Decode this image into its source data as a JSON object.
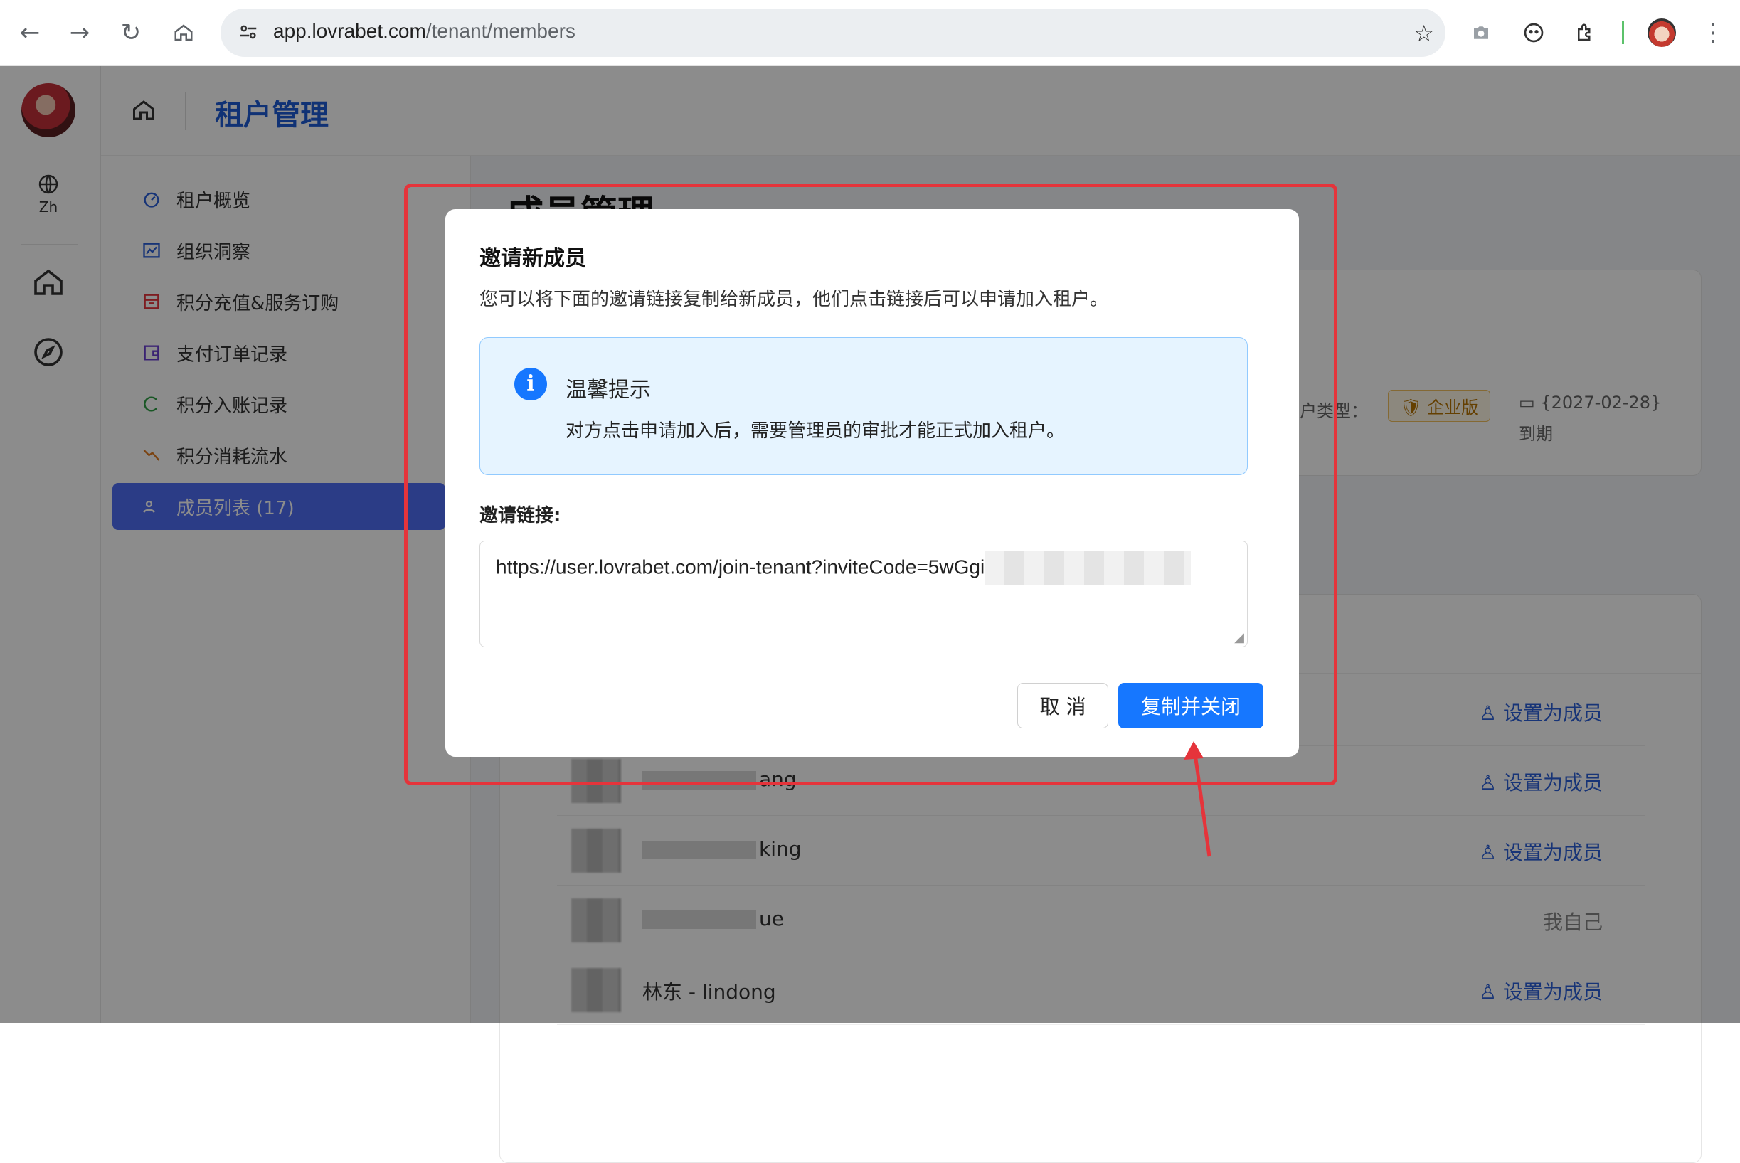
{
  "browser": {
    "url_host": "app.lovrabet.com",
    "url_path": "/tenant/members"
  },
  "rail": {
    "lang_label": "Zh"
  },
  "header": {
    "title": "租户管理"
  },
  "sidebar": {
    "items": [
      {
        "label": "租户概览",
        "icon": "dashboard-icon",
        "color": "#2b5fd9"
      },
      {
        "label": "组织洞察",
        "icon": "chart-icon",
        "color": "#2b5fd9"
      },
      {
        "label": "积分充值&服务订购",
        "icon": "store-icon",
        "color": "#e5343b"
      },
      {
        "label": "支付订单记录",
        "icon": "wallet-icon",
        "color": "#6b3fd1"
      },
      {
        "label": "积分入账记录",
        "icon": "credit-icon",
        "color": "#2f9e44"
      },
      {
        "label": "积分消耗流水",
        "icon": "trend-down-icon",
        "color": "#e07a1f"
      },
      {
        "label": "成员列表 (17)",
        "icon": "team-icon",
        "color": "#ffffff",
        "active": true
      }
    ]
  },
  "content": {
    "page_title": "成员管理",
    "tenant_type_label": "租户类型：",
    "tenant_type_value": "企业版",
    "expire_date": "{2027-02-28}",
    "expire_suffix": "到期",
    "members": [
      {
        "name_suffix": "ang",
        "action": "设置为成员"
      },
      {
        "name_suffix": "king",
        "action": "设置为成员"
      },
      {
        "name_suffix": "ue",
        "action": "我自己"
      },
      {
        "name_suffix": "林东 - lindong",
        "action": "设置为成员"
      }
    ],
    "first_row_action": "设置为成员"
  },
  "modal": {
    "title": "邀请新成员",
    "description": "您可以将下面的邀请链接复制给新成员，他们点击链接后可以申请加入租户。",
    "alert_title": "温馨提示",
    "alert_body": "对方点击申请加入后，需要管理员的审批才能正式加入租户。",
    "link_label": "邀请链接:",
    "link_value": "https://user.lovrabet.com/join-tenant?inviteCode=5wGgi",
    "cancel_label": "取 消",
    "confirm_label": "复制并关闭"
  },
  "colors": {
    "accent": "#1677ff",
    "highlight": "#e5343b"
  }
}
